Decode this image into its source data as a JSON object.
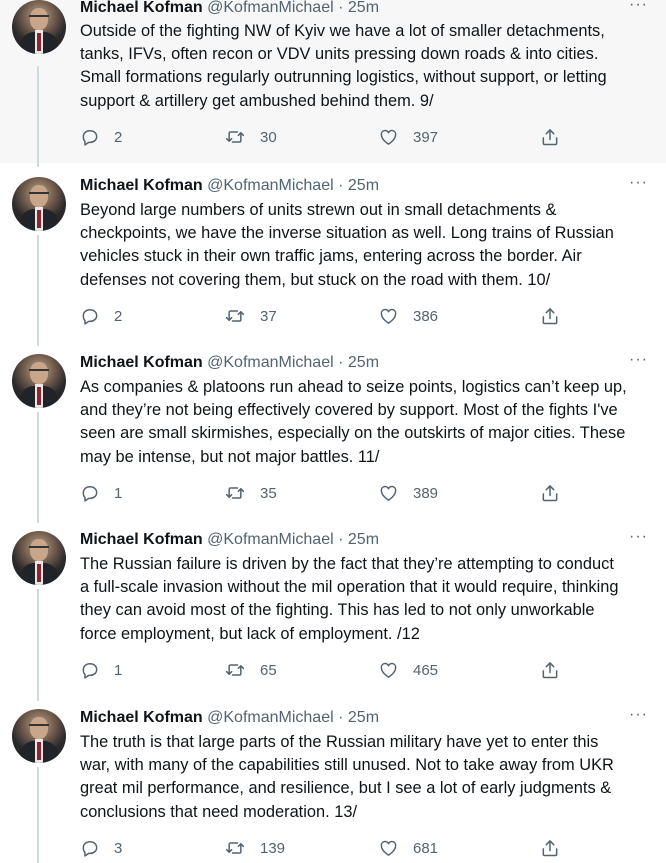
{
  "author": {
    "name": "Michael Kofman",
    "handle": "@KofmanMichael",
    "separator": "·"
  },
  "more_label": "···",
  "tweets": [
    {
      "time": "25m",
      "lines": [
        "Outside of the fighting NW of Kyiv we have a lot of smaller detachments,",
        "tanks, IFVs, often recon or VDV units pressing down roads & into cities.",
        "Small formations regularly outrunning logistics, without support, or letting",
        "support & artillery get ambushed behind them. 9/"
      ],
      "replies": "2",
      "retweets": "30",
      "likes": "397"
    },
    {
      "time": "25m",
      "lines": [
        "Beyond large numbers of units strewn out in small detachments &",
        "checkpoints, we have the inverse situation as well. Long trains of Russian",
        "vehicles stuck in their own traffic jams, entering across the border. Air",
        "defenses not covering them, but stuck on the road with them. 10/"
      ],
      "replies": "2",
      "retweets": "37",
      "likes": "386"
    },
    {
      "time": "25m",
      "lines": [
        "As companies & platoons run ahead to seize points, logistics can’t keep up,",
        "and they’re not being effectively covered by support. Most of the fights I've",
        "seen are small skirmishes, especially on the outskirts of major cities. These",
        "may be intense, but not major battles. 11/"
      ],
      "replies": "1",
      "retweets": "35",
      "likes": "389"
    },
    {
      "time": "25m",
      "lines": [
        "The Russian failure is driven by the fact that they’re attempting to conduct",
        "a full-scale invasion without the mil operation that it would require, thinking",
        "they can avoid most of the fighting. This has led to not only unworkable",
        "force employment, but lack of employment. /12"
      ],
      "replies": "1",
      "retweets": "65",
      "likes": "465"
    },
    {
      "time": "25m",
      "lines": [
        "The truth is that large parts of the Russian military have yet to enter this",
        "war, with many of the capabilities still unused. Not to take away from UKR",
        "great mil performance, and resilience, but I see a lot of early judgments &",
        "conclusions that need moderation. 13/"
      ],
      "replies": "3",
      "retweets": "139",
      "likes": "681"
    }
  ],
  "colors": {
    "text": "#0f1419",
    "secondary": "#536471",
    "thread_line": "#cfd9de",
    "highlight_bg": "#f7f7f7"
  },
  "icons": [
    "reply-icon",
    "retweet-icon",
    "like-icon",
    "share-icon",
    "more-icon"
  ]
}
